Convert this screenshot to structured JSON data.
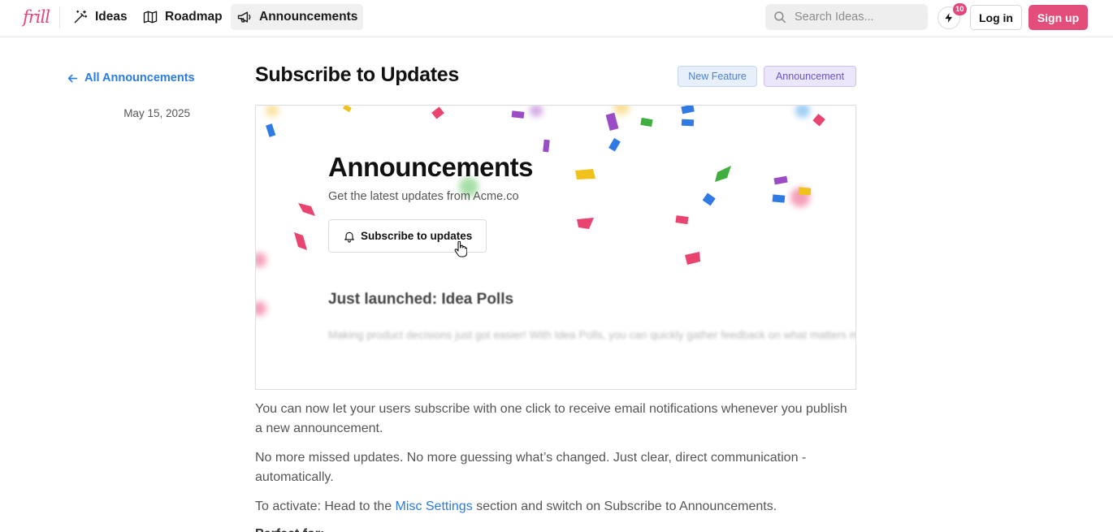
{
  "brand": {
    "logo_text": "frill"
  },
  "nav": {
    "items": [
      {
        "label": "Ideas",
        "icon": "magic-wand-icon"
      },
      {
        "label": "Roadmap",
        "icon": "map-icon"
      },
      {
        "label": "Announcements",
        "icon": "megaphone-icon",
        "active": true
      }
    ]
  },
  "search": {
    "placeholder": "Search Ideas...",
    "value": ""
  },
  "notifications": {
    "count": "10",
    "icon": "lightning-bolt-icon"
  },
  "auth": {
    "login_label": "Log in",
    "signup_label": "Sign up",
    "signup_color": "#e34d7a"
  },
  "sidebar": {
    "back_label": "All Announcements",
    "date": "May 15, 2025"
  },
  "post": {
    "title": "Subscribe to Updates",
    "tags": [
      {
        "label": "New Feature",
        "color": "#4f7fc9"
      },
      {
        "label": "Announcement",
        "color": "#6c54c4"
      }
    ],
    "hero": {
      "heading": "Announcements",
      "subtitle": "Get the latest updates from Acme.co",
      "button_label": "Subscribe to updates",
      "section_title": "Just launched: Idea Polls",
      "blurred_text": "Making product decisions just got easier! With Idea Polls, you can quickly gather feedback on what matters most to your customers."
    },
    "paragraphs": {
      "p1": "You can now let your users subscribe with one click to receive email notifications whenever you publish a new announcement.",
      "p2": "No more missed updates. No more guessing what’s changed. Just clear, direct communication - automatically.",
      "p3_before": "To activate: Head to the ",
      "p3_link": "Misc Settings",
      "p3_after": " section and switch on Subscribe to Announcements.",
      "p4": "Perfect for:"
    }
  }
}
